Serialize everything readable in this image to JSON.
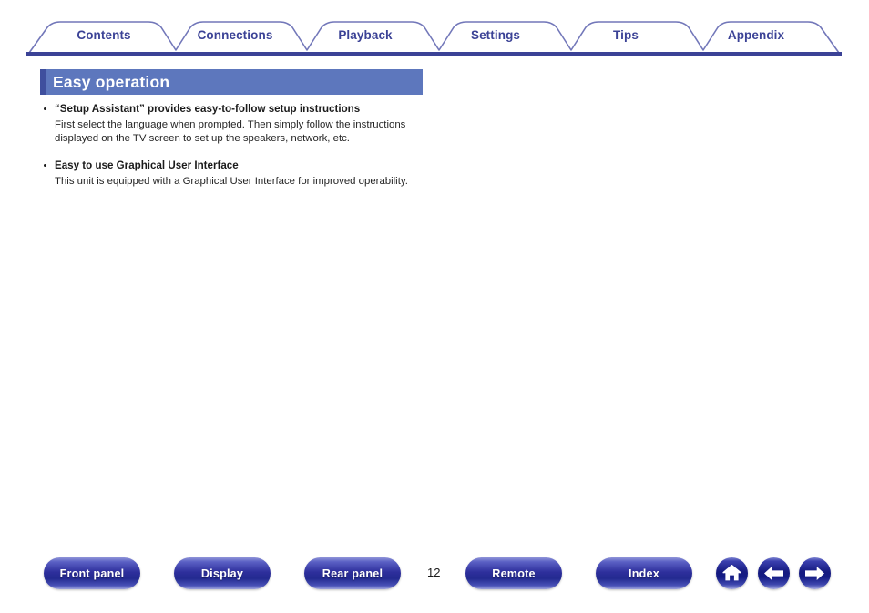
{
  "colors": {
    "tab_text": "#3b4296",
    "tab_outline": "#6b6fb5",
    "tab_baseline": "#3b4296",
    "title_bar_bg": "#5d77bd",
    "title_bar_accent": "#3f4f9e",
    "title_text": "#ffffff",
    "body_text": "#252525",
    "button_blue": "#232a90"
  },
  "tabs": [
    {
      "label": "Contents",
      "name": "tab-contents"
    },
    {
      "label": "Connections",
      "name": "tab-connections"
    },
    {
      "label": "Playback",
      "name": "tab-playback"
    },
    {
      "label": "Settings",
      "name": "tab-settings"
    },
    {
      "label": "Tips",
      "name": "tab-tips"
    },
    {
      "label": "Appendix",
      "name": "tab-appendix"
    }
  ],
  "section": {
    "title": "Easy operation"
  },
  "content": {
    "bullets": [
      {
        "heading": "“Setup Assistant” provides easy-to-follow setup instructions",
        "body": "First select the language when prompted. Then simply follow the instructions displayed on the TV screen to set up the speakers, network, etc."
      },
      {
        "heading": "Easy to use Graphical User Interface",
        "body": "This unit is equipped with a Graphical User Interface for improved operability."
      }
    ]
  },
  "footer": {
    "page_number": "12",
    "buttons": [
      {
        "label": "Front panel",
        "name": "footer-button-front-panel"
      },
      {
        "label": "Display",
        "name": "footer-button-display"
      },
      {
        "label": "Rear panel",
        "name": "footer-button-rear-panel"
      },
      {
        "label": "Remote",
        "name": "footer-button-remote"
      },
      {
        "label": "Index",
        "name": "footer-button-index"
      }
    ],
    "icons": [
      {
        "icon": "home-icon",
        "name": "footer-home-button"
      },
      {
        "icon": "arrow-left-icon",
        "name": "footer-previous-button"
      },
      {
        "icon": "arrow-right-icon",
        "name": "footer-next-button"
      }
    ]
  }
}
